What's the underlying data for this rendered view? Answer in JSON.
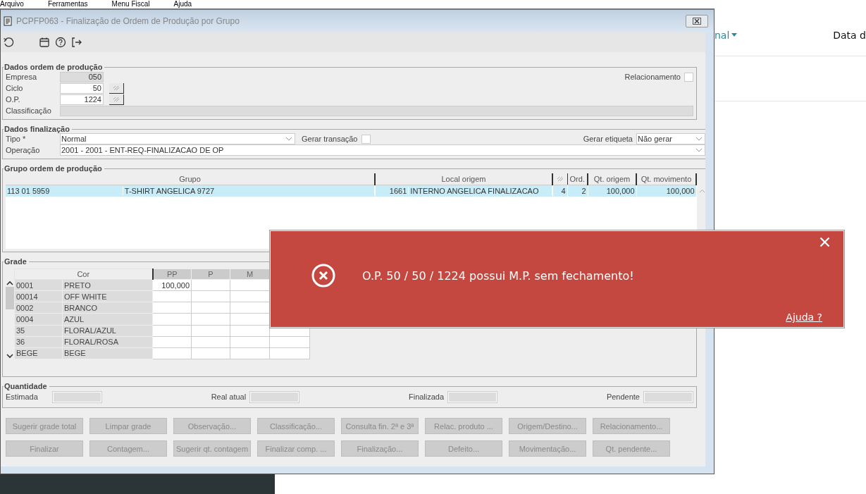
{
  "menu": [
    "Arquivo",
    "Ferramentas",
    "Menu Fiscal",
    "Ajuda"
  ],
  "background": {
    "link": "nal",
    "header": "Data d"
  },
  "window": {
    "title": "PCPFP063 - Finalização de Ordem de Produção por Grupo"
  },
  "production_order": {
    "title": "Dados ordem de produção",
    "fields": [
      {
        "label": "Empresa",
        "value": "050",
        "disabled": true,
        "lookup": false
      },
      {
        "label": "Ciclo",
        "value": "50",
        "disabled": false,
        "lookup": true
      },
      {
        "label": "O.P.",
        "value": "1224",
        "disabled": false,
        "lookup": true
      }
    ],
    "classification": {
      "label": "Classificação",
      "disabled": true
    },
    "relationship": {
      "label": "Relacionamento",
      "checked": false
    }
  },
  "finalization": {
    "title": "Dados finalização",
    "type": {
      "label": "Tipo *",
      "value": "Normal"
    },
    "generate_transaction": {
      "label": "Gerar transação",
      "checked": false
    },
    "generate_label": {
      "label": "Gerar etiqueta",
      "value": "Não gerar"
    },
    "operation": {
      "label": "Operação",
      "value": "2001 - 2001 - ENT-REQ-FINALIZACAO DE OP"
    }
  },
  "group": {
    "title": "Grupo ordem de produção",
    "columns": [
      {
        "label": "Grupo",
        "kind": "text"
      },
      {
        "label": "Local origem",
        "kind": "text"
      },
      {
        "kind": "icon"
      },
      {
        "label": "Ord.",
        "kind": "text"
      },
      {
        "label": "Qt. origem",
        "kind": "text"
      },
      {
        "label": "Qt. movimento",
        "kind": "text"
      }
    ],
    "rows": [
      {
        "selected": true,
        "cells": [
          [
            "113 01 5959",
            "T-SHIRT ANGELICA 9727"
          ],
          [
            "1661",
            "INTERNO ANGELICA FINALIZACAO"
          ],
          "4",
          "2",
          "100,000",
          "100,000"
        ]
      }
    ]
  },
  "grade": {
    "title": "Grade",
    "columns": [
      "Cor",
      "PP",
      "P",
      "M"
    ],
    "rows": [
      {
        "code": "0001",
        "name": "PRETO",
        "values": [
          "100,000"
        ]
      },
      {
        "code": "00014",
        "name": "OFF WHITE"
      },
      {
        "code": "0002",
        "name": "BRANCO"
      },
      {
        "code": "0004",
        "name": "AZUL"
      },
      {
        "code": "35",
        "name": "FLORAL/AZUL"
      },
      {
        "code": "36",
        "name": "FLORAL/ROSA"
      },
      {
        "code": "BEGE",
        "name": "BEGE"
      }
    ]
  },
  "quantity": {
    "title": "Quantidade",
    "fields": [
      {
        "label": "Estimada"
      },
      {
        "label": "Real atual"
      },
      {
        "label": "Finalizada"
      },
      {
        "label": "Pendente"
      }
    ]
  },
  "buttons": [
    {
      "label": "Sugerir grade total",
      "disabled": true
    },
    {
      "label": "Limpar grade",
      "disabled": true
    },
    {
      "label": "Observação...",
      "disabled": true
    },
    {
      "label": "Classificação...",
      "disabled": true
    },
    {
      "label": "Consulta fin. 2ª e 3ª",
      "disabled": true
    },
    {
      "label": "Relac. produto ...",
      "disabled": true
    },
    {
      "label": "Origem/Destino...",
      "disabled": true
    },
    {
      "label": "Relacionamento...",
      "disabled": true
    },
    {
      "label": "Finalizar",
      "disabled": true
    },
    {
      "label": "Contagem...",
      "disabled": true
    },
    {
      "label": "Sugerir qt. contagem",
      "disabled": true
    },
    {
      "label": "Finalizar comp. ...",
      "disabled": true
    },
    {
      "label": "Finalização...",
      "disabled": true
    },
    {
      "label": "Defeito...",
      "disabled": true
    },
    {
      "label": "Movimentação...",
      "disabled": true
    },
    {
      "label": "Qt. pendente...",
      "disabled": true
    }
  ],
  "toast": {
    "message": "O.P. 50 / 50 / 1224 possui M.P. sem fechamento!",
    "link": "Ajuda ?"
  }
}
